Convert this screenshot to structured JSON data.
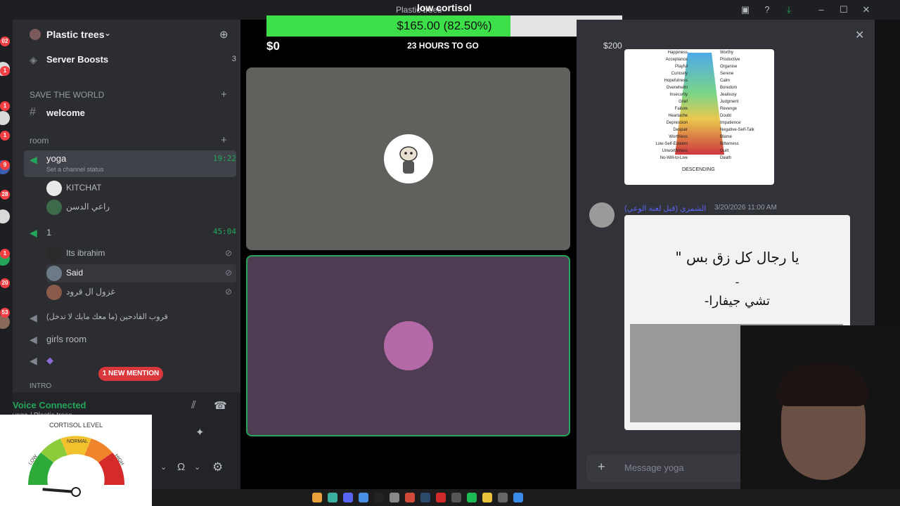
{
  "overlay": {
    "title": "low cortisol"
  },
  "window": {
    "title": "Plastic trees"
  },
  "rail": {
    "badges": [
      "02",
      "1",
      "1",
      "1",
      "9",
      "28",
      "1",
      "20",
      "53"
    ]
  },
  "server": {
    "name": "Plastic trees"
  },
  "channels": {
    "boosts_label": "Server Boosts",
    "boosts_count": "3",
    "category_save": "SAVE THE WORLD",
    "welcome": "welcome",
    "category_room": "room",
    "yoga": {
      "name": "yoga",
      "time": "19:22",
      "status": "Set a channel status",
      "users": [
        "KITCHAT",
        "راعي الدسن"
      ]
    },
    "one": {
      "name": "1",
      "time": "45:04",
      "users": [
        "Its ibrahim",
        "Said",
        "غزول ال قرود"
      ]
    },
    "arabic_channel": "قروب القادحين (ما معك مايك لا تدخل)",
    "girls_room": "girls room",
    "gamepad_channel_icon": "gamepad-icon",
    "new_mention": "1 NEW MENTION",
    "category_intro": "INTRO"
  },
  "voice": {
    "title": "Voice Connected",
    "subtitle": "yoga / Plastic trees"
  },
  "cortisol": {
    "title": "CORTISOL LEVEL",
    "labels": [
      "LOW",
      "NORMAL",
      "HIGH"
    ],
    "level": 0.05
  },
  "goal": {
    "raised": "$165.00 (82.50%)",
    "percent": 82.5,
    "current": "$0",
    "target": "$200",
    "time_left": "23 HOURS TO GO"
  },
  "chat": {
    "image_words_left": [
      "Happiness",
      "Acceptance",
      "Playful",
      "Curiosity",
      "Hopefulness",
      "Overwhelm",
      "Insecurity",
      "Grief",
      "Failure",
      "Heartache",
      "Depression",
      "Despair",
      "Worthless",
      "Low-Self-Esteem",
      "Unworthiness",
      "No-Will-to-Live"
    ],
    "image_words_right": [
      "Worthy",
      "Productive",
      "Organise",
      "Serene",
      "Calm",
      "Boredom",
      "Jealousy",
      "Judgment",
      "Revenge",
      "Doubt",
      "Impatience",
      "Negative-Self-Talk",
      "Blame",
      "Bitterness",
      "Guilt",
      "Death"
    ],
    "image_bottom": "DESCENDING",
    "author": "الشمري (قبل لعنة الوعي)",
    "timestamp": "3/20/2026 11:00 AM",
    "quote_lines": [
      "\" يا رجال كل زق بس",
      "-",
      "-تشي جيفارا"
    ],
    "composer_placeholder": "Message yoga"
  },
  "colors": {
    "green": "#23a55a",
    "red": "#f23f43",
    "blurple": "#5865f2"
  }
}
